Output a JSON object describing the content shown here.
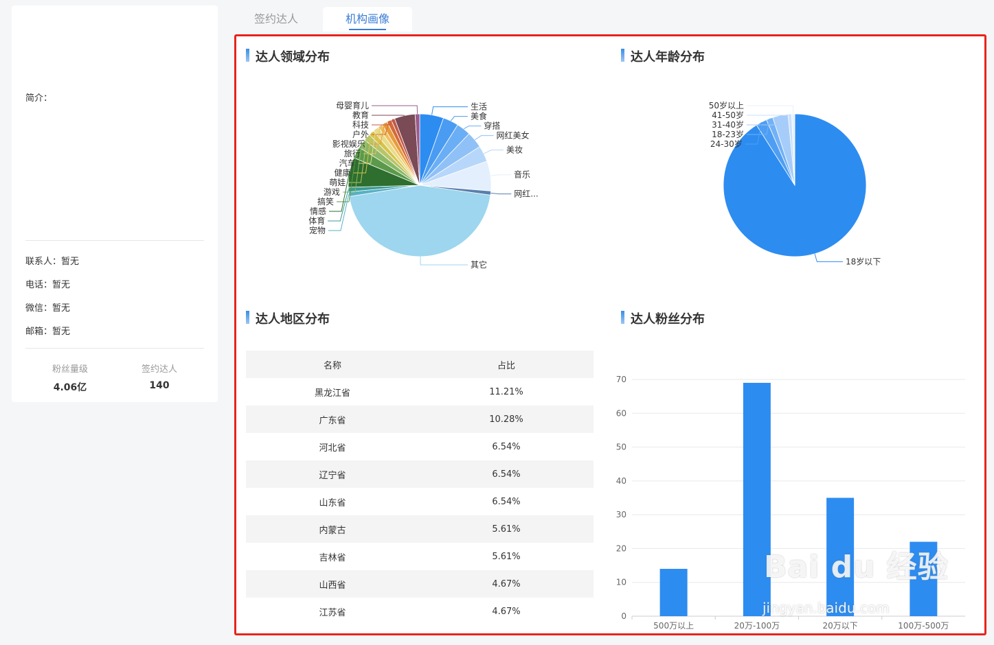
{
  "profile": {
    "intro_label": "简介：",
    "contact_label": "联系人：暂无",
    "phone_label": "电话：暂无",
    "wechat_label": "微信：暂无",
    "email_label": "邮箱：暂无",
    "fans_label": "粉丝量级",
    "fans_value": "4.06亿",
    "signed_label": "签约达人",
    "signed_value": "140"
  },
  "tabs": [
    {
      "label": "签约达人",
      "active": false
    },
    {
      "label": "机构画像",
      "active": true
    }
  ],
  "sections": {
    "domain_title": "达人领域分布",
    "age_title": "达人年龄分布",
    "region_title": "达人地区分布",
    "fans_title": "达人粉丝分布"
  },
  "region_table": {
    "headers": [
      "名称",
      "占比"
    ],
    "rows": [
      {
        "name": "黑龙江省",
        "pct": "11.21%"
      },
      {
        "name": "广东省",
        "pct": "10.28%"
      },
      {
        "name": "河北省",
        "pct": "6.54%"
      },
      {
        "name": "辽宁省",
        "pct": "6.54%"
      },
      {
        "name": "山东省",
        "pct": "6.54%"
      },
      {
        "name": "内蒙古",
        "pct": "5.61%"
      },
      {
        "name": "吉林省",
        "pct": "5.61%"
      },
      {
        "name": "山西省",
        "pct": "4.67%"
      },
      {
        "name": "江苏省",
        "pct": "4.67%"
      }
    ]
  },
  "watermark": {
    "main": "Bai du 经验",
    "sub": "jingyan.baidu.com"
  },
  "chart_data": [
    {
      "type": "pie",
      "slices": [
        {
          "label": "生活",
          "value": 5.2,
          "color": "#2d8cf0"
        },
        {
          "label": "美食",
          "value": 3.4,
          "color": "#4a9cf2"
        },
        {
          "label": "穿搭",
          "value": 3.1,
          "color": "#6aaef5"
        },
        {
          "label": "网红美女",
          "value": 3.6,
          "color": "#8fc1f7"
        },
        {
          "label": "美妆",
          "value": 3.5,
          "color": "#b7d7fa"
        },
        {
          "label": "音乐",
          "value": 6.5,
          "color": "#e3effc"
        },
        {
          "label": "网红...",
          "value": 0.9,
          "color": "#5a7fae"
        },
        {
          "label": "其它",
          "value": 43.6,
          "color": "#9dd6ee"
        },
        {
          "label": "宠物",
          "value": 1.0,
          "color": "#58b0c6"
        },
        {
          "label": "体育",
          "value": 1.0,
          "color": "#3a9c93"
        },
        {
          "label": "情感",
          "value": 6.5,
          "color": "#2e6e2e"
        },
        {
          "label": "搞笑",
          "value": 2.5,
          "color": "#5a9a4a"
        },
        {
          "label": "游戏",
          "value": 2.0,
          "color": "#8ab866"
        },
        {
          "label": "萌娃",
          "value": 1.5,
          "color": "#b8c46a"
        },
        {
          "label": "健康",
          "value": 1.2,
          "color": "#d6c44a"
        },
        {
          "label": "汽车",
          "value": 1.3,
          "color": "#e8dc8a"
        },
        {
          "label": "旅行",
          "value": 1.0,
          "color": "#f0c060"
        },
        {
          "label": "影视娱乐",
          "value": 1.2,
          "color": "#e89a3a"
        },
        {
          "label": "户外",
          "value": 1.0,
          "color": "#d46a3a"
        },
        {
          "label": "科技",
          "value": 0.8,
          "color": "#c05a4a"
        },
        {
          "label": "教育",
          "value": 4.5,
          "color": "#7a4a56"
        },
        {
          "label": "母婴育儿",
          "value": 1.0,
          "color": "#9a5a8a"
        }
      ]
    },
    {
      "type": "pie",
      "slices": [
        {
          "label": "18岁以下",
          "value": 91,
          "color": "#2d8cf0"
        },
        {
          "label": "24-30岁",
          "value": 2.5,
          "color": "#4e9ef3"
        },
        {
          "label": "18-23岁",
          "value": 1.5,
          "color": "#72b1f6"
        },
        {
          "label": "31-40岁",
          "value": 3.5,
          "color": "#a6cdf9"
        },
        {
          "label": "41-50岁",
          "value": 0.8,
          "color": "#c9e0fb"
        },
        {
          "label": "50岁以上",
          "value": 0.7,
          "color": "#e6f0fd"
        }
      ]
    },
    {
      "type": "bar",
      "categories": [
        "500万以上",
        "20万-100万",
        "20万以下",
        "100万-500万"
      ],
      "values": [
        14,
        69,
        35,
        22
      ],
      "ylim": [
        0,
        70
      ],
      "yticks": [
        0,
        10,
        20,
        30,
        40,
        50,
        60,
        70
      ],
      "color": "#2d8cf0",
      "grid": true
    }
  ]
}
